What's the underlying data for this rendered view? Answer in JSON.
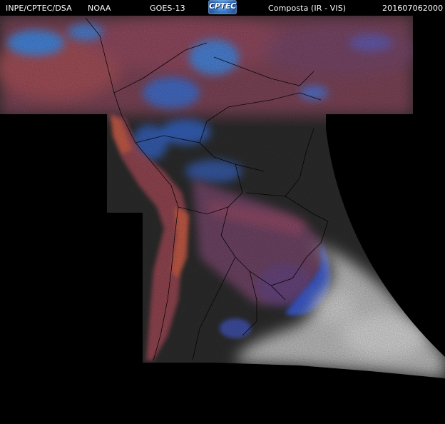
{
  "header": {
    "institution": "INPE/CPTEC/DSA",
    "agency": "NOAA",
    "satellite": "GOES-13",
    "logo_text": "CPTEC",
    "product": "Composta (IR - VIS)",
    "timestamp": "201607062000"
  },
  "colors": {
    "background": "#000000",
    "land": "#2e2e2e",
    "high_cloud": "#3a78e6",
    "mid_cloud": "#8a4a6a",
    "warm_cloud": "#c85a4a",
    "low_cloud": "#cfcfcf",
    "boundaries": "#000000"
  }
}
